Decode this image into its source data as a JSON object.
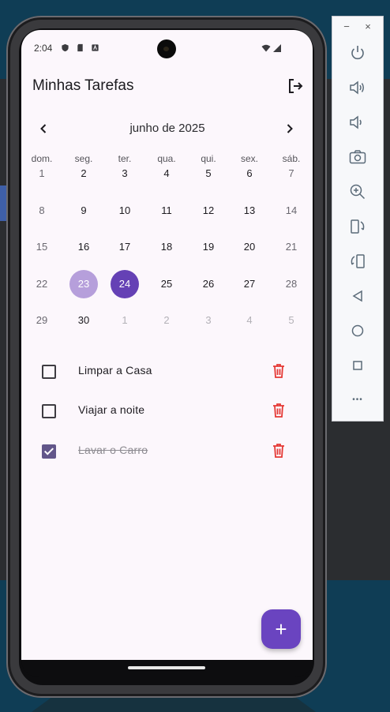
{
  "status": {
    "time": "2:04"
  },
  "app": {
    "title": "Minhas Tarefas"
  },
  "calendar": {
    "month_label": "junho de 2025",
    "weekdays": [
      "dom.",
      "seg.",
      "ter.",
      "qua.",
      "qui.",
      "sex.",
      "sáb."
    ],
    "weeks": [
      [
        "1",
        "2",
        "3",
        "4",
        "5",
        "6",
        "7"
      ],
      [
        "8",
        "9",
        "10",
        "11",
        "12",
        "13",
        "14"
      ],
      [
        "15",
        "16",
        "17",
        "18",
        "19",
        "20",
        "21"
      ],
      [
        "22",
        "23",
        "24",
        "25",
        "26",
        "27",
        "28"
      ],
      [
        "29",
        "30",
        "1",
        "2",
        "3",
        "4",
        "5"
      ]
    ],
    "today": "23",
    "selected": "24"
  },
  "tasks": [
    {
      "label": "Limpar a Casa",
      "done": false
    },
    {
      "label": "Viajar a noite",
      "done": false
    },
    {
      "label": "Lavar o Carro",
      "done": true
    }
  ],
  "colors": {
    "accent": "#6541b5",
    "today_bg": "#b69fdb",
    "delete": "#e53935",
    "screen_bg": "#fcf7fc"
  },
  "icons": {
    "logout": "logout-icon",
    "prev": "chevron-left-icon",
    "next": "chevron-right-icon",
    "delete": "trash-icon",
    "add": "plus-icon"
  },
  "emulator": {
    "minimize": "−",
    "close": "×",
    "fab_label": "+",
    "more": "•••"
  }
}
